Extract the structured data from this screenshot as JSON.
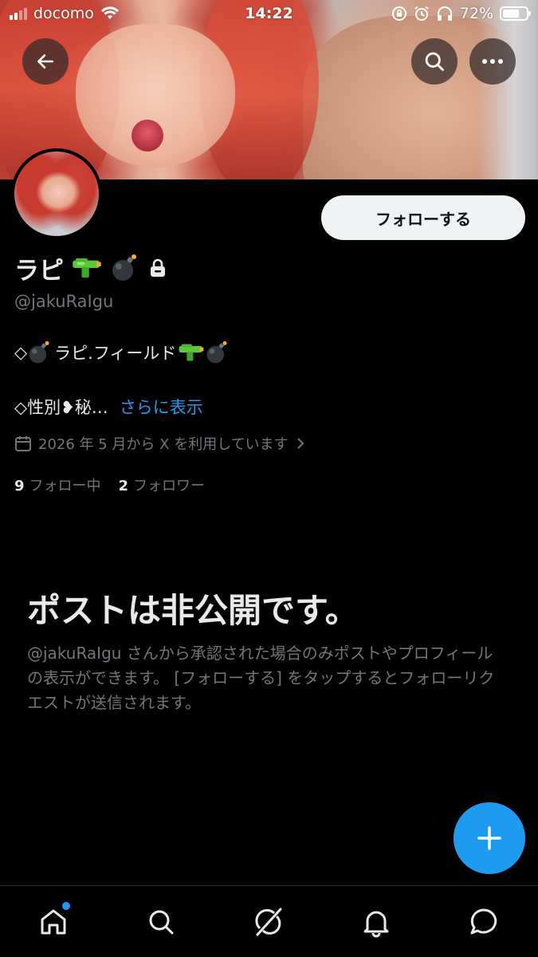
{
  "status_bar": {
    "carrier": "docomo",
    "time": "14:22",
    "battery_percent": "72%",
    "battery_level": 0.72,
    "icons": [
      "signal-icon",
      "wifi-icon",
      "orientation-lock-icon",
      "alarm-icon",
      "headphones-icon",
      "battery-icon"
    ]
  },
  "header": {
    "back_icon": "back-arrow-icon",
    "search_icon": "search-icon",
    "more_icon": "more-icon"
  },
  "profile": {
    "display_name": "ラピ",
    "name_emojis": [
      "water-pistol-emoji",
      "bomb-emoji"
    ],
    "protected_icon": "lock-icon",
    "handle": "@jakuRaIgu",
    "follow_button": "フォローする",
    "bio_line1_prefix": "◇",
    "bio_line1_text": "ラピ.フィールド",
    "bio_line2_text": "◇性別❥秘…",
    "show_more": "さらに表示",
    "joined": "2026 年 5 月から X を利用しています",
    "following_count": "9",
    "following_label": "フォロー中",
    "followers_count": "2",
    "followers_label": "フォロワー"
  },
  "private_notice": {
    "title": "ポストは非公開です。",
    "description": "@jakuRaIgu さんから承認された場合のみポストやプロフィールの表示ができます。 [フォローする] をタップするとフォローリクエストが送信されます。"
  },
  "fab": {
    "icon": "plus-icon"
  },
  "tabbar": {
    "items": [
      "home-icon",
      "search-icon",
      "grok-icon",
      "notifications-icon",
      "messages-icon"
    ]
  },
  "colors": {
    "accent": "#1d9bf0",
    "background": "#000000",
    "text": "#e7e9ea",
    "muted": "#71767b"
  }
}
